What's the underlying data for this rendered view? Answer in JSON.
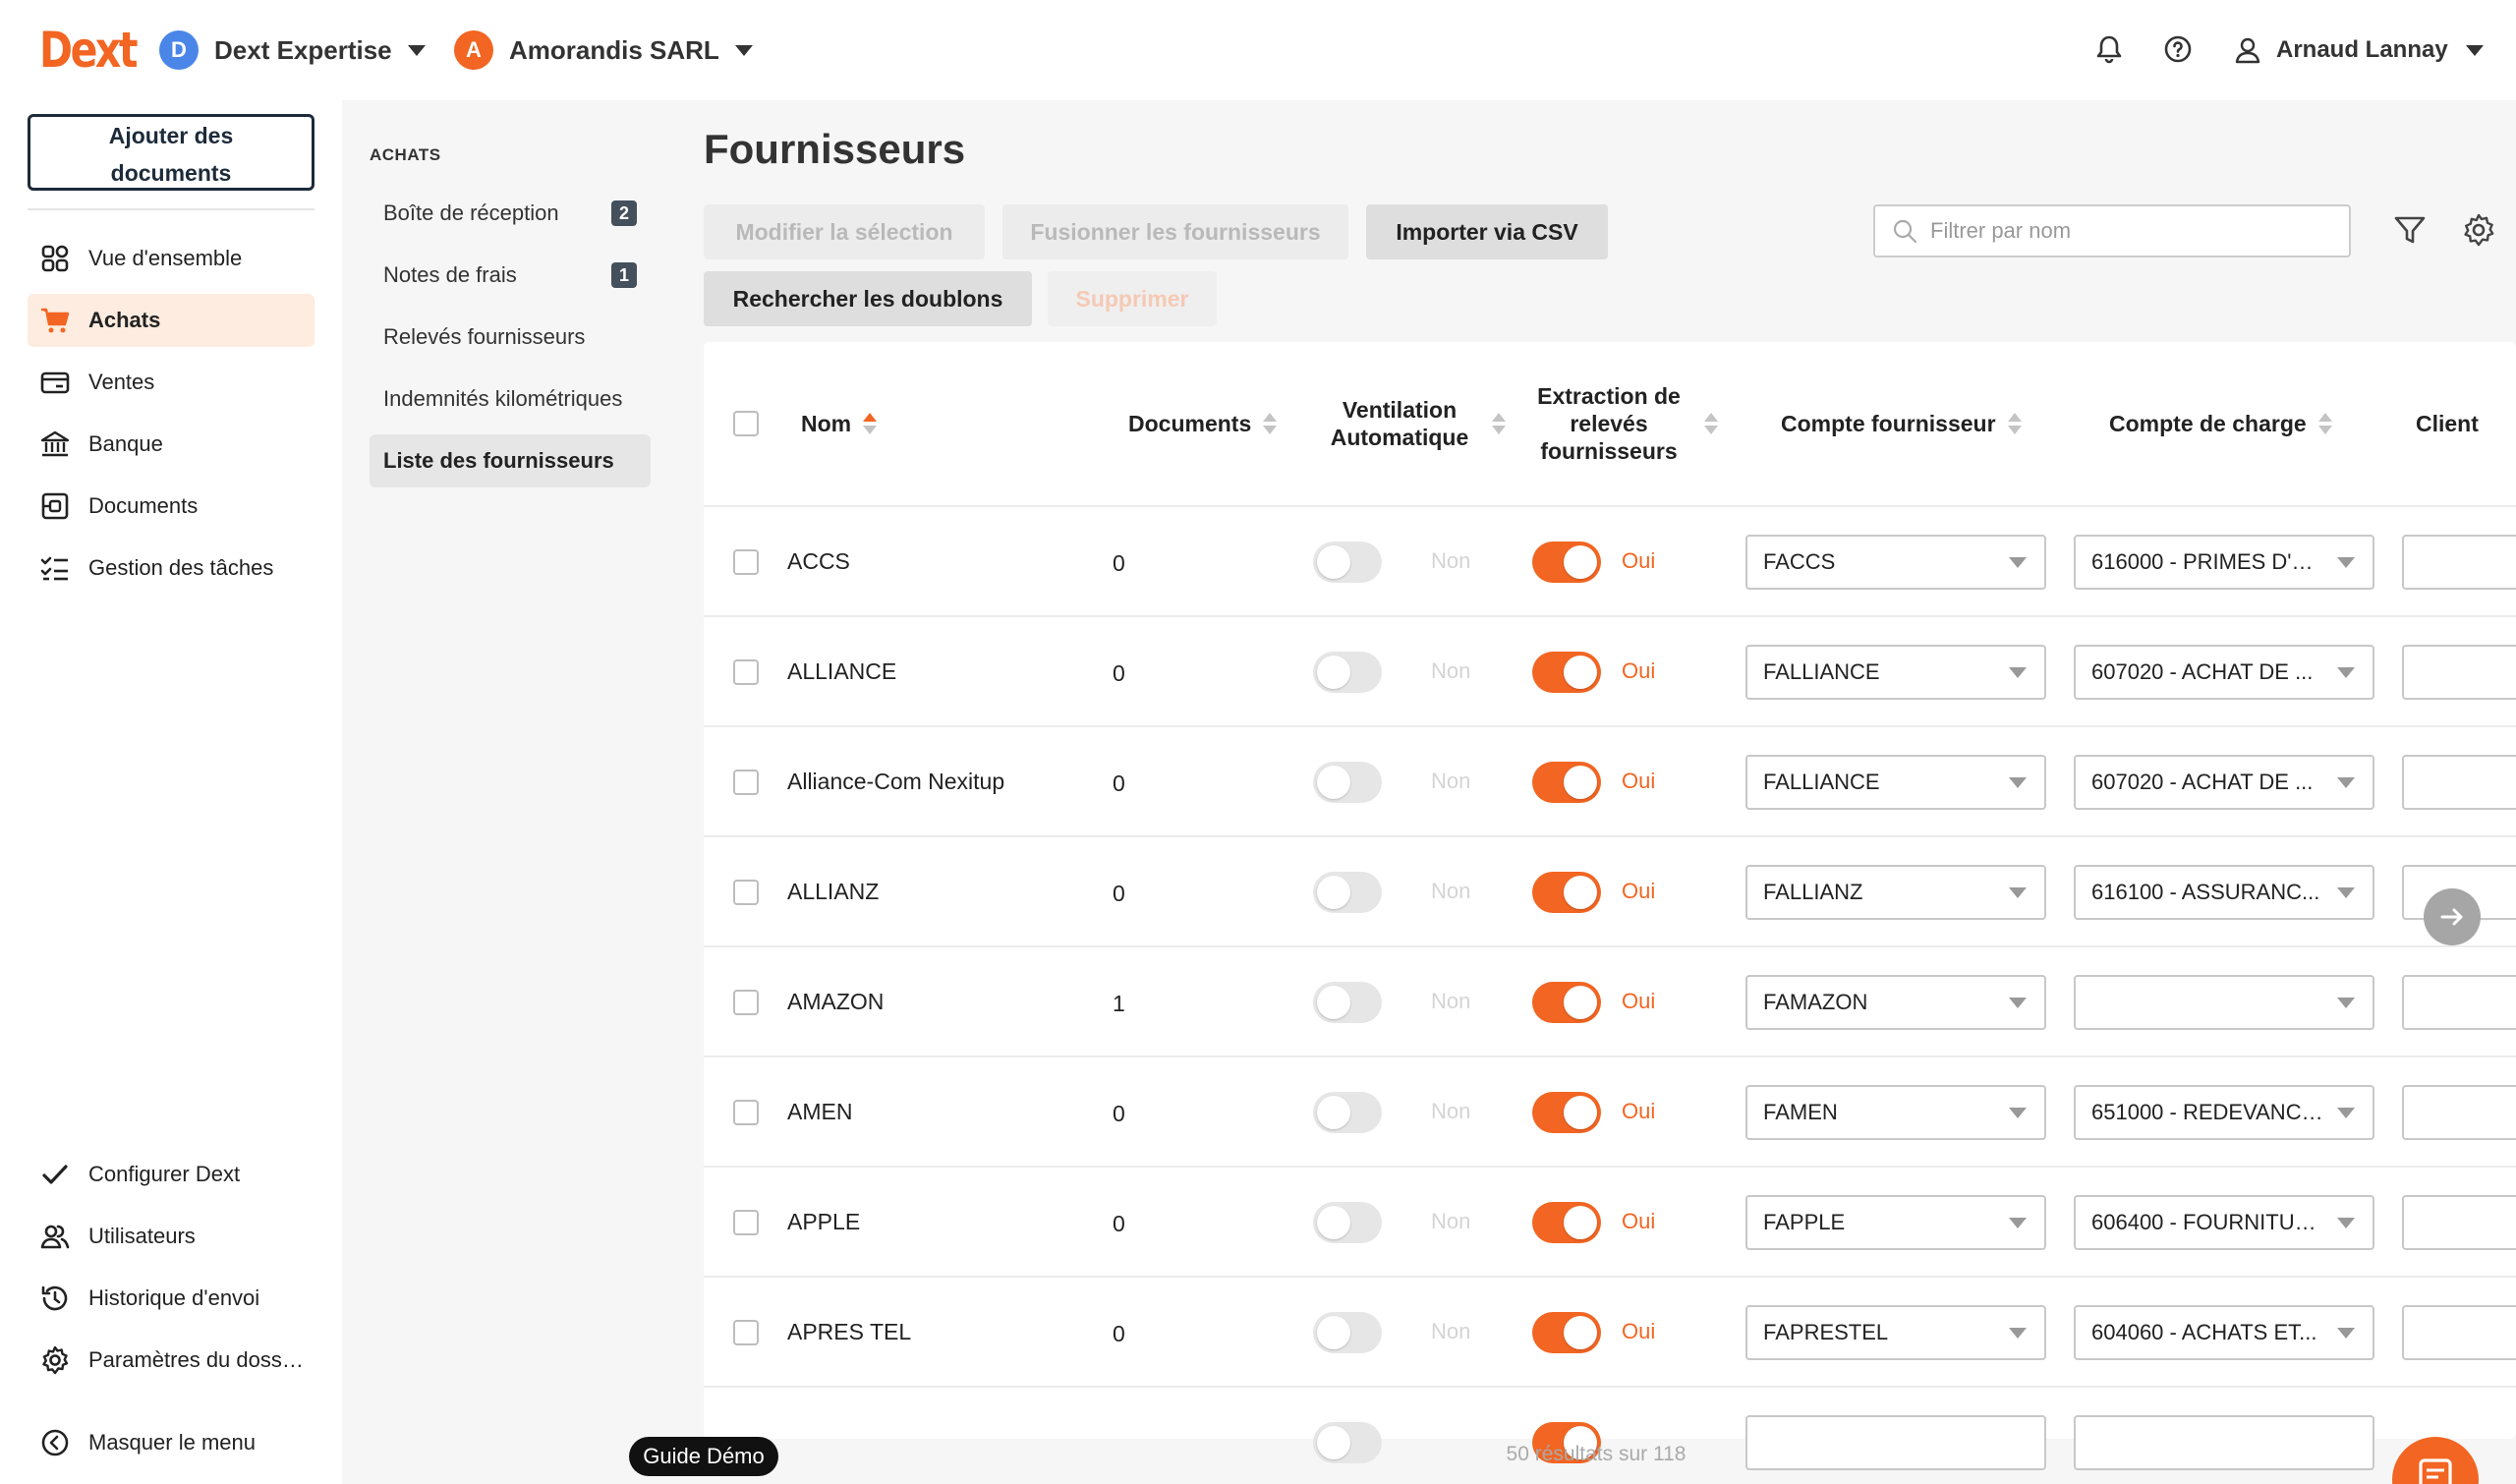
{
  "header": {
    "logo": "Dext",
    "org1": {
      "initial": "D",
      "name": "Dext Expertise",
      "color": "#4a86e8"
    },
    "org2": {
      "initial": "A",
      "name": "Amorandis SARL",
      "color": "#f26522"
    },
    "user_name": "Arnaud Lannay"
  },
  "sidebar": {
    "add_docs_label": "Ajouter des documents",
    "items": [
      {
        "label": "Vue d'ensemble",
        "icon": "dashboard-icon"
      },
      {
        "label": "Achats",
        "icon": "cart-icon",
        "active": true
      },
      {
        "label": "Ventes",
        "icon": "card-icon"
      },
      {
        "label": "Banque",
        "icon": "bank-icon"
      },
      {
        "label": "Documents",
        "icon": "document-icon"
      },
      {
        "label": "Gestion des tâches",
        "icon": "tasks-icon"
      }
    ],
    "bottom_items": [
      {
        "label": "Configurer Dext",
        "icon": "check-icon"
      },
      {
        "label": "Utilisateurs",
        "icon": "users-icon"
      },
      {
        "label": "Historique d'envoi",
        "icon": "history-icon"
      },
      {
        "label": "Paramètres du doss…",
        "icon": "gear-icon"
      },
      {
        "label": "Masquer le menu",
        "icon": "chevron-left-circle-icon"
      }
    ]
  },
  "subsidebar": {
    "title": "ACHATS",
    "items": [
      {
        "label": "Boîte de réception",
        "badge": "2"
      },
      {
        "label": "Notes de frais",
        "badge": "1"
      },
      {
        "label": "Relevés fournisseurs",
        "badge": ""
      },
      {
        "label": "Indemnités kilométriques",
        "badge": ""
      },
      {
        "label": "Liste des fournisseurs",
        "badge": "",
        "active": true
      }
    ]
  },
  "main": {
    "title": "Fournisseurs",
    "buttons": {
      "modify": "Modifier la sélection",
      "merge": "Fusionner les fournisseurs",
      "import": "Importer via CSV",
      "duplicates": "Rechercher les doublons",
      "delete": "Supprimer"
    },
    "search_placeholder": "Filtrer par nom",
    "columns": {
      "name": "Nom",
      "documents": "Documents",
      "ventilation": "Ventilation Automatique",
      "extraction": "Extraction de relevés fournisseurs",
      "supplier_account": "Compte fournisseur",
      "charge_account": "Compte de charge",
      "client": "Client"
    },
    "toggle_off_label": "Non",
    "toggle_on_label": "Oui",
    "rows": [
      {
        "name": "ACCS",
        "documents": "0",
        "supplier_account": "FACCS",
        "charge_account": "616000 - PRIMES D'A..."
      },
      {
        "name": "ALLIANCE",
        "documents": "0",
        "supplier_account": "FALLIANCE",
        "charge_account": "607020 - ACHAT DE ..."
      },
      {
        "name": "Alliance-Com Nexitup",
        "documents": "0",
        "supplier_account": "FALLIANCE",
        "charge_account": "607020 - ACHAT DE ..."
      },
      {
        "name": "ALLIANZ",
        "documents": "0",
        "supplier_account": "FALLIANZ",
        "charge_account": "616100 - ASSURANC..."
      },
      {
        "name": "AMAZON",
        "documents": "1",
        "supplier_account": "FAMAZON",
        "charge_account": ""
      },
      {
        "name": "AMEN",
        "documents": "0",
        "supplier_account": "FAMEN",
        "charge_account": "651000 - REDEVANCE..."
      },
      {
        "name": "APPLE",
        "documents": "0",
        "supplier_account": "FAPPLE",
        "charge_account": "606400 - FOURNITUR..."
      },
      {
        "name": "APRES TEL",
        "documents": "0",
        "supplier_account": "FAPRESTEL",
        "charge_account": "604060 - ACHATS ET..."
      }
    ],
    "results_text": "50 résultats sur 118"
  },
  "guide_label": "Guide Démo",
  "colors": {
    "accent": "#f26522",
    "active_bg": "#fdecdf"
  }
}
